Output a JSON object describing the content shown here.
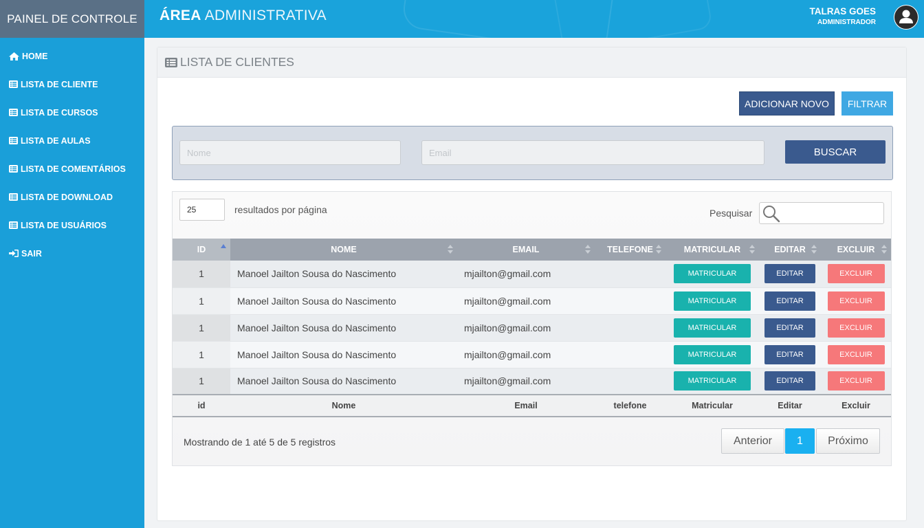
{
  "sidebar": {
    "brand": "PAINEL DE CONTROLE",
    "items": [
      {
        "label": "HOME",
        "icon": "home-icon"
      },
      {
        "label": "LISTA DE CLIENTE",
        "icon": "list-icon"
      },
      {
        "label": "LISTA DE CURSOS",
        "icon": "list-icon"
      },
      {
        "label": "LISTA DE AULAS",
        "icon": "list-icon"
      },
      {
        "label": "LISTA DE COMENTÁRIOS",
        "icon": "list-icon"
      },
      {
        "label": "LISTA DE DOWNLOAD",
        "icon": "list-icon"
      },
      {
        "label": "LISTA DE USUÁRIOS",
        "icon": "list-icon"
      },
      {
        "label": "SAIR",
        "icon": "sign-in-icon"
      }
    ]
  },
  "header": {
    "title_bold": "ÁREA",
    "title_light": "ADMINISTRATIVA",
    "user_name": "TALRAS GOES",
    "user_role": "ADMINISTRADOR"
  },
  "panel": {
    "title": "LISTA DE CLIENTES",
    "add_button": "ADICIONAR NOVO",
    "filter_button": "FILTRAR"
  },
  "filter": {
    "nome_placeholder": "Nome",
    "email_placeholder": "Email",
    "search_button": "BUSCAR"
  },
  "table": {
    "page_length": "25",
    "page_length_label": "resultados por página",
    "search_label": "Pesquisar",
    "headers": [
      "ID",
      "NOME",
      "EMAIL",
      "TELEFONE",
      "MATRICULAR",
      "EDITAR",
      "EXCLUIR"
    ],
    "footers": [
      "id",
      "Nome",
      "Email",
      "telefone",
      "Matricular",
      "Editar",
      "Excluir"
    ],
    "rows": [
      {
        "id": "1",
        "nome": "Manoel Jailton Sousa do Nascimento",
        "email": "mjailton@gmail.com",
        "telefone": "",
        "matricular": "MATRICULAR",
        "editar": "EDITAR",
        "excluir": "EXCLUIR"
      },
      {
        "id": "1",
        "nome": "Manoel Jailton Sousa do Nascimento",
        "email": "mjailton@gmail.com",
        "telefone": "",
        "matricular": "MATRICULAR",
        "editar": "EDITAR",
        "excluir": "EXCLUIR"
      },
      {
        "id": "1",
        "nome": "Manoel Jailton Sousa do Nascimento",
        "email": "mjailton@gmail.com",
        "telefone": "",
        "matricular": "MATRICULAR",
        "editar": "EDITAR",
        "excluir": "EXCLUIR"
      },
      {
        "id": "1",
        "nome": "Manoel Jailton Sousa do Nascimento",
        "email": "mjailton@gmail.com",
        "telefone": "",
        "matricular": "MATRICULAR",
        "editar": "EDITAR",
        "excluir": "EXCLUIR"
      },
      {
        "id": "1",
        "nome": "Manoel Jailton Sousa do Nascimento",
        "email": "mjailton@gmail.com",
        "telefone": "",
        "matricular": "MATRICULAR",
        "editar": "EDITAR",
        "excluir": "EXCLUIR"
      }
    ],
    "info": "Mostrando de 1 até 5 de 5 registros",
    "pagination": {
      "prev": "Anterior",
      "current": "1",
      "next": "Próximo"
    }
  },
  "colors": {
    "sidebar": "#1a9fd9",
    "brand_bar": "#5a7086",
    "primary_dark": "#3a5a8e",
    "filter_blue": "#3fa8e3",
    "teal": "#19b2ad",
    "danger": "#f6787a",
    "page_active": "#1ab0f0"
  }
}
